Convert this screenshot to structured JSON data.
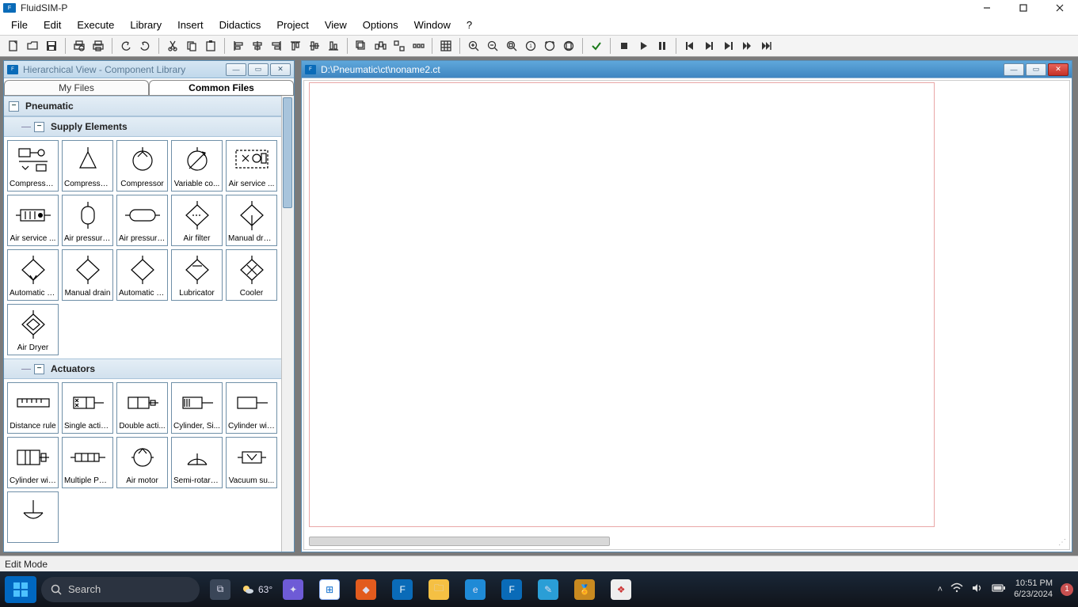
{
  "app": {
    "title": "FluidSIM-P"
  },
  "menubar": [
    "File",
    "Edit",
    "Execute",
    "Library",
    "Insert",
    "Didactics",
    "Project",
    "View",
    "Options",
    "Window",
    "?"
  ],
  "toolbar_groups": [
    [
      "new",
      "open",
      "save"
    ],
    [
      "print-preview",
      "print"
    ],
    [
      "undo",
      "redo"
    ],
    [
      "cut",
      "copy",
      "paste"
    ],
    [
      "align-left",
      "align-center",
      "align-right",
      "align-top",
      "align-middle",
      "align-bottom"
    ],
    [
      "rotate-left",
      "group",
      "ungroup",
      "distribute"
    ],
    [
      "grid"
    ],
    [
      "zoom-in",
      "zoom-out",
      "zoom-fit",
      "zoom-100",
      "zoom-region",
      "zoom-page"
    ],
    [
      "check"
    ],
    [
      "stop",
      "play",
      "pause"
    ],
    [
      "step-back",
      "step-play",
      "step-fwd",
      "skip-fwd",
      "skip-end"
    ]
  ],
  "library_panel": {
    "title": "Hierarchical View - Component Library",
    "tabs": {
      "inactive": "My Files",
      "active": "Common Files"
    },
    "root_category": "Pneumatic",
    "groups": [
      {
        "name": "Supply Elements",
        "components": [
          {
            "label": "Compresse...",
            "sym": "compressor-system"
          },
          {
            "label": "Compresse...",
            "sym": "triangle-up"
          },
          {
            "label": "Compressor",
            "sym": "circle-tick"
          },
          {
            "label": "Variable co...",
            "sym": "circle-arrow"
          },
          {
            "label": "Air service ...",
            "sym": "service-unit"
          },
          {
            "label": "Air service ...",
            "sym": "filter-reg-box"
          },
          {
            "label": "Air pressure...",
            "sym": "capsule"
          },
          {
            "label": "Air pressure...",
            "sym": "capsule-wide"
          },
          {
            "label": "Air filter",
            "sym": "diamond-dash"
          },
          {
            "label": "Manual drai...",
            "sym": "diamond-line"
          },
          {
            "label": "Automatic d...",
            "sym": "diamond-tri"
          },
          {
            "label": "Manual drain",
            "sym": "diamond-plain"
          },
          {
            "label": "Automatic d...",
            "sym": "diamond-plain2"
          },
          {
            "label": "Lubricator",
            "sym": "diamond-dot"
          },
          {
            "label": "Cooler",
            "sym": "diamond-x"
          },
          {
            "label": "Air Dryer",
            "sym": "diamond-double"
          }
        ]
      },
      {
        "name": "Actuators",
        "components": [
          {
            "label": "Distance rule",
            "sym": "ruler"
          },
          {
            "label": "Single actin...",
            "sym": "cyl-single"
          },
          {
            "label": "Double acti...",
            "sym": "cyl-double"
          },
          {
            "label": "Cylinder, Si...",
            "sym": "cyl-simple"
          },
          {
            "label": "Cylinder wit...",
            "sym": "cyl-plain"
          },
          {
            "label": "Cylinder wit...",
            "sym": "cyl-multi"
          },
          {
            "label": "Multiple Pos...",
            "sym": "cyl-multipos"
          },
          {
            "label": "Air motor",
            "sym": "motor-circle"
          },
          {
            "label": "Semi-rotary...",
            "sym": "semi-rotary"
          },
          {
            "label": "Vacuum su...",
            "sym": "vacuum"
          },
          {
            "label": "",
            "sym": "suction-cup"
          }
        ]
      }
    ]
  },
  "document_panel": {
    "path": "D:\\Pneumatic\\ct\\noname2.ct"
  },
  "statusbar": {
    "mode": "Edit Mode"
  },
  "taskbar": {
    "search_placeholder": "Search",
    "weather": "63°",
    "time": "10:51 PM",
    "date": "6/23/2024",
    "notifications": "1"
  }
}
